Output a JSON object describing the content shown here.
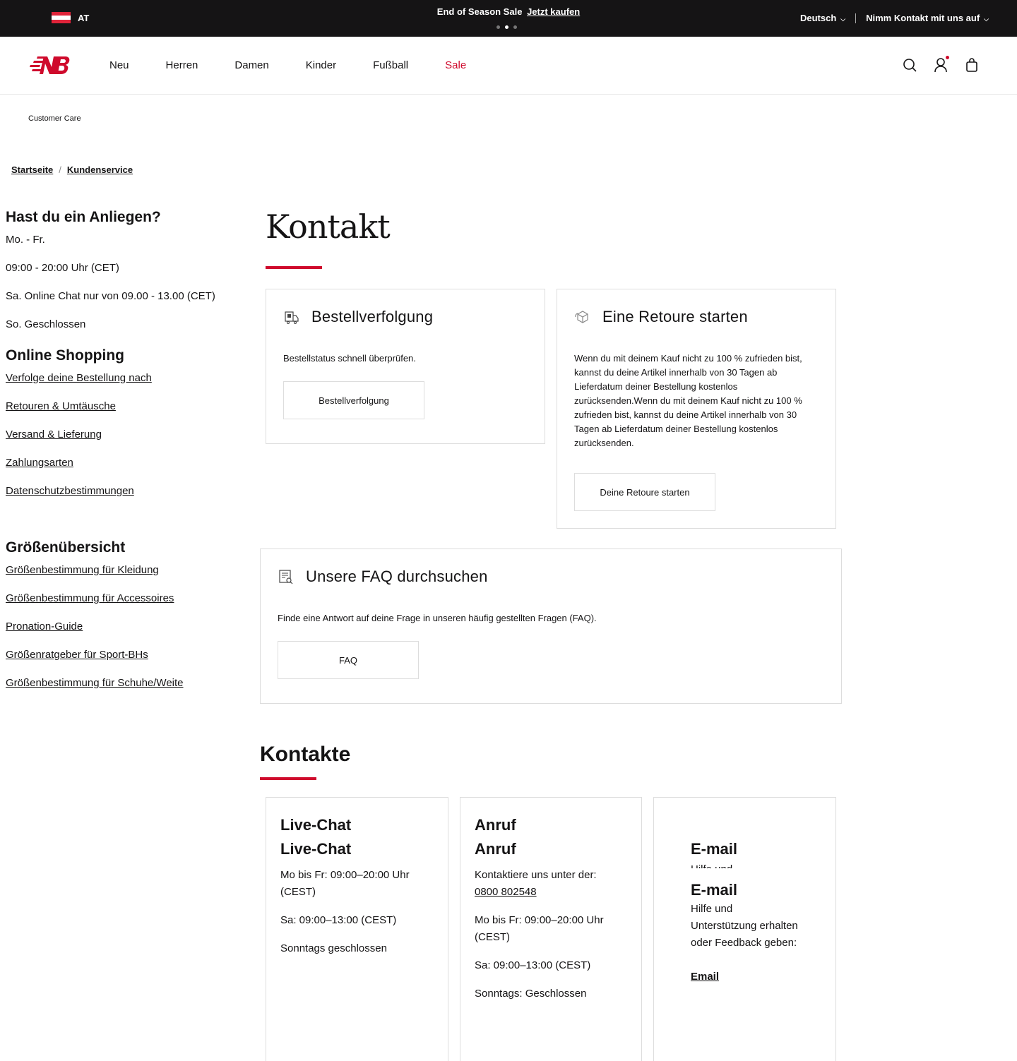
{
  "topbar": {
    "country": "AT",
    "promo_text": "End of Season Sale",
    "promo_cta": "Jetzt kaufen",
    "language": "Deutsch",
    "contact": "Nimm Kontakt mit uns auf"
  },
  "nav": {
    "items": [
      "Neu",
      "Herren",
      "Damen",
      "Kinder",
      "Fußball",
      "Sale"
    ]
  },
  "page_label": "Customer Care",
  "breadcrumb": {
    "home": "Startseite",
    "current": "Kundenservice"
  },
  "sidebar": {
    "concern_title": "Hast du ein Anliegen?",
    "hours": [
      "Mo. - Fr.",
      "09:00 - 20:00 Uhr (CET)",
      "Sa. Online Chat nur von 09.00 - 13.00 (CET)",
      "So. Geschlossen"
    ],
    "shopping_title": "Online Shopping",
    "shopping_links": [
      "Verfolge deine Bestellung nach",
      "Retouren & Umtäusche",
      "Versand & Lieferung",
      "Zahlungsarten",
      "Datenschutzbestimmungen"
    ],
    "size_title": "Größenübersicht",
    "size_links": [
      "Größenbestimmung für Kleidung",
      "Größenbestimmung für Accessoires",
      "Pronation-Guide",
      "Größenratgeber für Sport-BHs",
      "Größenbestimmung für Schuhe/Weite"
    ]
  },
  "main": {
    "title": "Kontakt",
    "tracking": {
      "title": "Bestellverfolgung",
      "text": "Bestellstatus schnell überprüfen.",
      "button": "Bestellverfolgung"
    },
    "returns": {
      "title": "Eine Retoure starten",
      "text": "Wenn du mit deinem Kauf nicht zu 100 % zufrieden bist, kannst du deine Artikel innerhalb von 30 Tagen ab Lieferdatum deiner Bestellung kostenlos zurücksenden.Wenn du mit deinem Kauf nicht zu 100 % zufrieden bist, kannst du deine Artikel innerhalb von 30 Tagen ab Lieferdatum deiner Bestellung kostenlos zurücksenden.",
      "button": "Deine Retoure starten"
    },
    "faq": {
      "title": "Unsere FAQ durchsuchen",
      "text": "Finde eine Antwort auf deine Frage in unseren häufig gestellten Fragen (FAQ).",
      "button": "FAQ"
    },
    "contacts_title": "Kontakte",
    "livechat": {
      "title": "Live-Chat",
      "line1": "Mo bis Fr: 09:00–20:00 Uhr (CEST)",
      "line2": "Sa: 09:00–13:00 (CEST)",
      "line3": "Sonntags geschlossen"
    },
    "call": {
      "title": "Anruf",
      "intro": "Kontaktiere uns unter der:",
      "phone": "0800 802548",
      "line1": "Mo bis Fr: 09:00–20:00 Uhr (CEST)",
      "line2": "Sa: 09:00–13:00 (CEST)",
      "line3": "Sonntags: Geschlossen"
    },
    "email": {
      "title": "E-mail",
      "text": "Hilfe und Unterstützung erhalten oder Feedback geben:",
      "link": "Email"
    }
  },
  "colors": {
    "brand_red": "#cf0a2c",
    "topbar_bg": "#151415"
  }
}
